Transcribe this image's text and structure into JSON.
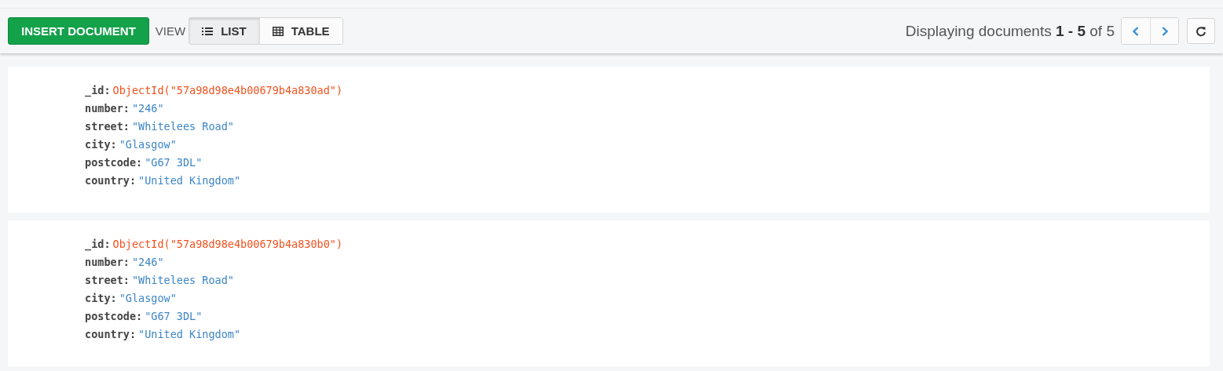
{
  "toolbar": {
    "insert_button": "INSERT DOCUMENT",
    "view_label": "VIEW",
    "view_tabs": [
      {
        "label": "LIST",
        "selected": true
      },
      {
        "label": "TABLE",
        "selected": false
      }
    ],
    "pagination_text": "Displaying documents **1 - 5** of 5"
  },
  "documents": [
    {
      "fields": [
        {
          "key": "_id:",
          "value": "ObjectId(\"57a98d98e4b00679b4a830ad\")",
          "kind": "objectid"
        },
        {
          "key": "number:",
          "value": "\"246\"",
          "kind": "string"
        },
        {
          "key": "street:",
          "value": "\"Whitelees Road\"",
          "kind": "string"
        },
        {
          "key": "city:",
          "value": "\"Glasgow\"",
          "kind": "string"
        },
        {
          "key": "postcode:",
          "value": "\"G67 3DL\"",
          "kind": "string"
        },
        {
          "key": "country:",
          "value": "\"United Kingdom\"",
          "kind": "string"
        }
      ]
    },
    {
      "fields": [
        {
          "key": "_id:",
          "value": "ObjectId(\"57a98d98e4b00679b4a830b0\")",
          "kind": "objectid"
        },
        {
          "key": "number:",
          "value": "\"246\"",
          "kind": "string"
        },
        {
          "key": "street:",
          "value": "\"Whitelees Road\"",
          "kind": "string"
        },
        {
          "key": "city:",
          "value": "\"Glasgow\"",
          "kind": "string"
        },
        {
          "key": "postcode:",
          "value": "\"G67 3DL\"",
          "kind": "string"
        },
        {
          "key": "country:",
          "value": "\"United Kingdom\"",
          "kind": "string"
        }
      ]
    }
  ]
}
